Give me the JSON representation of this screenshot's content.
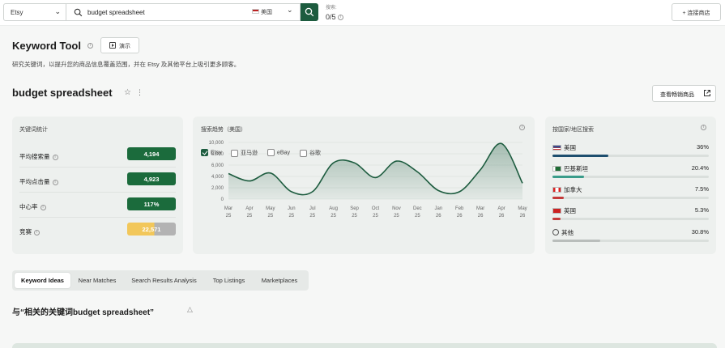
{
  "topbar": {
    "platform": "Etsy",
    "search_value": "budget spreadsheet",
    "country": "美国",
    "quota_label": "搜索:",
    "quota_value": "0/5",
    "connect_label": "+ 连接商店"
  },
  "tool": {
    "title": "Keyword Tool",
    "demo_label": "演示",
    "description": "研究关键词，以提升您的商品信息覆盖范围，并在 Etsy 及其他平台上吸引更多顾客。"
  },
  "keyword": {
    "title": "budget spreadsheet",
    "similar_label": "查看畅销商品"
  },
  "stats": {
    "title": "关键词统计",
    "rows": [
      {
        "label": "平均搜索量",
        "value": "4,194",
        "color": "#1b6b3c"
      },
      {
        "label": "平均点击量",
        "value": "4,923",
        "color": "#1b6b3c"
      },
      {
        "label": "中心率",
        "value": "117%",
        "color": "#1b6b3c"
      },
      {
        "label": "竞赛",
        "value": "22,571",
        "color": "#f2c75a",
        "fill_fraction": 0.56
      }
    ]
  },
  "trend": {
    "title": "搜索趋势（美国）",
    "legend": [
      {
        "label": "Etsy",
        "checked": true
      },
      {
        "label": "亚马逊",
        "checked": false
      },
      {
        "label": "eBay",
        "checked": false
      },
      {
        "label": "谷歌",
        "checked": false
      }
    ]
  },
  "chart_data": {
    "type": "area",
    "title": "搜索趋势（美国）",
    "x": [
      "Mar 25",
      "Apr 25",
      "May 25",
      "Jun 25",
      "Jul 25",
      "Aug 25",
      "Sep 25",
      "Oct 25",
      "Nov 25",
      "Dec 25",
      "Jan 26",
      "Feb 26",
      "Mar 26",
      "Apr 26",
      "May 26"
    ],
    "x_top": [
      "Mar",
      "Apr",
      "May",
      "Jun",
      "Jul",
      "Aug",
      "Sep",
      "Oct",
      "Nov",
      "Dec",
      "Jan",
      "Feb",
      "Mar",
      "Apr",
      "May"
    ],
    "x_bottom": [
      "25",
      "25",
      "25",
      "25",
      "25",
      "25",
      "25",
      "25",
      "25",
      "25",
      "26",
      "26",
      "26",
      "26",
      "26"
    ],
    "series": [
      {
        "values": [
          4500,
          3200,
          4600,
          1300,
          1300,
          6400,
          6400,
          3800,
          6700,
          4800,
          1500,
          1300,
          5200,
          9800,
          2800
        ]
      }
    ],
    "yticks": [
      "0",
      "2,000",
      "4,000",
      "6,000",
      "8,000",
      "10,000"
    ],
    "ylim": [
      0,
      10000
    ],
    "grid": true,
    "color": "#1d5c3f"
  },
  "countries": {
    "title": "按国家/地区搜索",
    "rows": [
      {
        "name": "美国",
        "pct": "36%",
        "value": 0.36,
        "color": "#1d4e6e",
        "flag": "us"
      },
      {
        "name": "巴基斯坦",
        "pct": "20.4%",
        "value": 0.204,
        "color": "#3a9c8a",
        "flag": "pk"
      },
      {
        "name": "加拿大",
        "pct": "7.5%",
        "value": 0.075,
        "color": "#c43a3a",
        "flag": "ca"
      },
      {
        "name": "英国",
        "pct": "5.3%",
        "value": 0.053,
        "color": "#c43a3a",
        "flag": "gb"
      },
      {
        "name": "其他",
        "pct": "30.8%",
        "value": 0.308,
        "color": "#b9bdbb",
        "flag": "globe"
      }
    ]
  },
  "tabs": [
    {
      "label": "Keyword Ideas",
      "active": true
    },
    {
      "label": "Near Matches",
      "active": false
    },
    {
      "label": "Search Results Analysis",
      "active": false
    },
    {
      "label": "Top Listings",
      "active": false
    },
    {
      "label": "Marketplaces",
      "active": false
    }
  ],
  "related": {
    "title": "与“相关的关键词budget spreadsheet”"
  }
}
